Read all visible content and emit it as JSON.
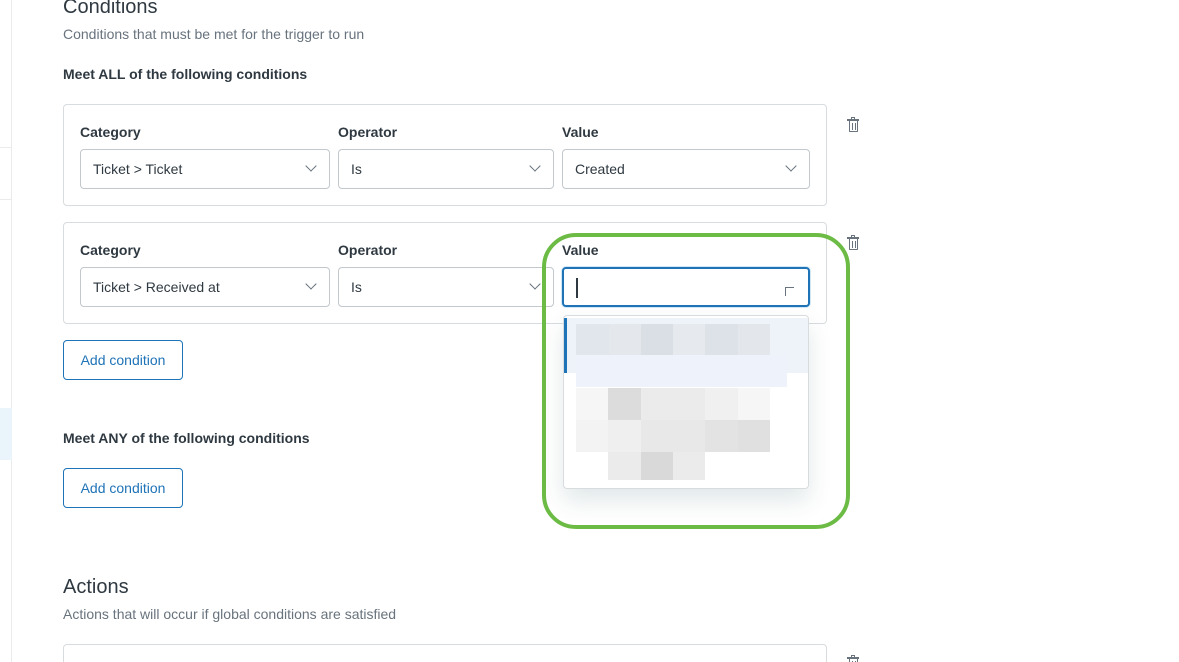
{
  "conditions": {
    "title": "Conditions",
    "subtitle": "Conditions that must be met for the trigger to run",
    "all_label": "Meet ALL of the following conditions",
    "any_label": "Meet ANY of the following conditions",
    "add_condition_label": "Add condition",
    "rows": [
      {
        "category_label": "Category",
        "operator_label": "Operator",
        "value_label": "Value",
        "category": "Ticket > Ticket",
        "operator": "Is",
        "value": "Created"
      },
      {
        "category_label": "Category",
        "operator_label": "Operator",
        "value_label": "Value",
        "category": "Ticket > Received at",
        "operator": "Is",
        "value": ""
      }
    ]
  },
  "actions": {
    "title": "Actions",
    "subtitle": "Actions that will occur if global conditions are satisfied"
  },
  "value_dropdown": {
    "state": "open",
    "options_obscured": true
  },
  "colors": {
    "accent": "#1f73b7",
    "highlight_ring": "#6cbb45",
    "border": "#d8dcde",
    "text": "#2f3941",
    "muted": "#68737d"
  }
}
